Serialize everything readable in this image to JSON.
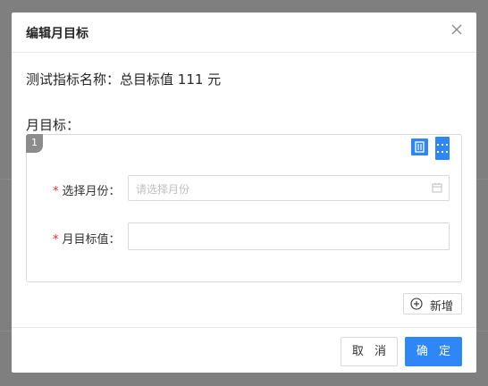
{
  "dialog": {
    "title": "编辑月目标",
    "summary": "测试指标名称：总目标值 111 元",
    "section_label": "月目标：",
    "card": {
      "index": "1",
      "month_field": {
        "label": "选择月份：",
        "placeholder": "请选择月份",
        "value": ""
      },
      "target_field": {
        "label": "月目标值：",
        "value": ""
      }
    },
    "add_label": "新增",
    "cancel_label": "取 消",
    "ok_label": "确 定"
  },
  "colors": {
    "primary": "#2f86f6",
    "required": "#f5222d"
  },
  "icons": [
    "close-icon",
    "delete-icon",
    "drag-handle-icon",
    "calendar-icon",
    "plus-circle-icon"
  ]
}
